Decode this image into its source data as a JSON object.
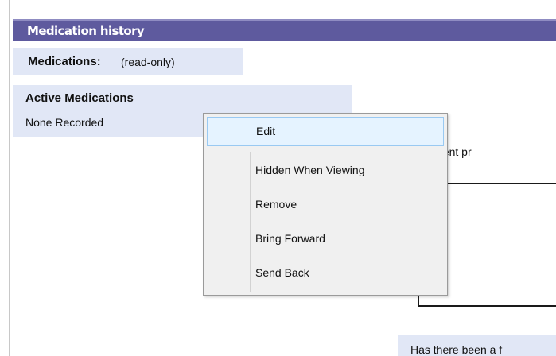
{
  "section": {
    "title": "Medication history"
  },
  "medications": {
    "label": "Medications:",
    "note": "(read-only)"
  },
  "active_medications": {
    "title": "Active Medications",
    "value": "None Recorded"
  },
  "question": {
    "label": "s the patient pr"
  },
  "question2": {
    "label": "Has there been a f"
  },
  "context_menu": {
    "items": [
      {
        "label": "Edit"
      },
      {
        "label": "Hidden When Viewing"
      },
      {
        "label": "Remove"
      },
      {
        "label": "Bring Forward"
      },
      {
        "label": "Send Back"
      }
    ]
  },
  "colors": {
    "header_bg": "#5e5a9e",
    "field_bg": "#e1e7f6",
    "menu_bg": "#f0f0f0",
    "menu_highlight": "#e5f3ff",
    "menu_highlight_border": "#99c9f2"
  }
}
